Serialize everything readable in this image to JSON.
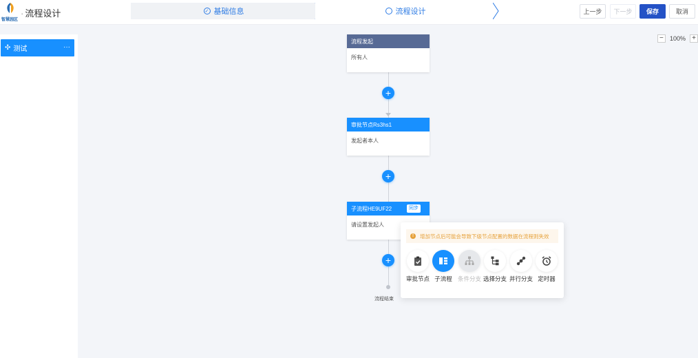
{
  "header": {
    "logo_text": "智慧园区",
    "title": "流程设计",
    "steps": [
      {
        "label": "基础信息",
        "icon": "check-circle-icon"
      },
      {
        "label": "流程设计",
        "icon": "circle-icon"
      }
    ],
    "buttons": {
      "prev": "上一步",
      "next": "下一步",
      "save": "保存",
      "cancel": "取消"
    }
  },
  "sidebar": {
    "items": [
      {
        "label": "测试",
        "icon": "move-icon",
        "more": "···"
      }
    ]
  },
  "canvas": {
    "zoom": "100%",
    "nodes": [
      {
        "title": "流程发起",
        "body": "所有人",
        "kind": "start"
      },
      {
        "title": "审批节点Rs3hs1",
        "body": "发起者本人",
        "kind": "approval"
      },
      {
        "title": "子流程HE9UF22",
        "body": "请设置发起人",
        "kind": "subprocess",
        "tag": "同步"
      }
    ],
    "end_label": "流程结束"
  },
  "popover": {
    "warning": "增加节点后可能会导致下级节点配置的数据在流程则失效",
    "types": [
      {
        "label": "审批节点",
        "icon": "clipboard-check-icon",
        "state": "normal"
      },
      {
        "label": "子流程",
        "icon": "subprocess-icon",
        "state": "active"
      },
      {
        "label": "条件分支",
        "icon": "condition-branch-icon",
        "state": "disabled"
      },
      {
        "label": "选择分支",
        "icon": "select-branch-icon",
        "state": "normal"
      },
      {
        "label": "并行分支",
        "icon": "parallel-branch-icon",
        "state": "normal"
      },
      {
        "label": "定时器",
        "icon": "alarm-clock-icon",
        "state": "normal"
      }
    ]
  },
  "colors": {
    "primary": "#1890ff",
    "start_node": "#576a95",
    "save_button": "#2452c6",
    "warning": "#e6a23c"
  }
}
